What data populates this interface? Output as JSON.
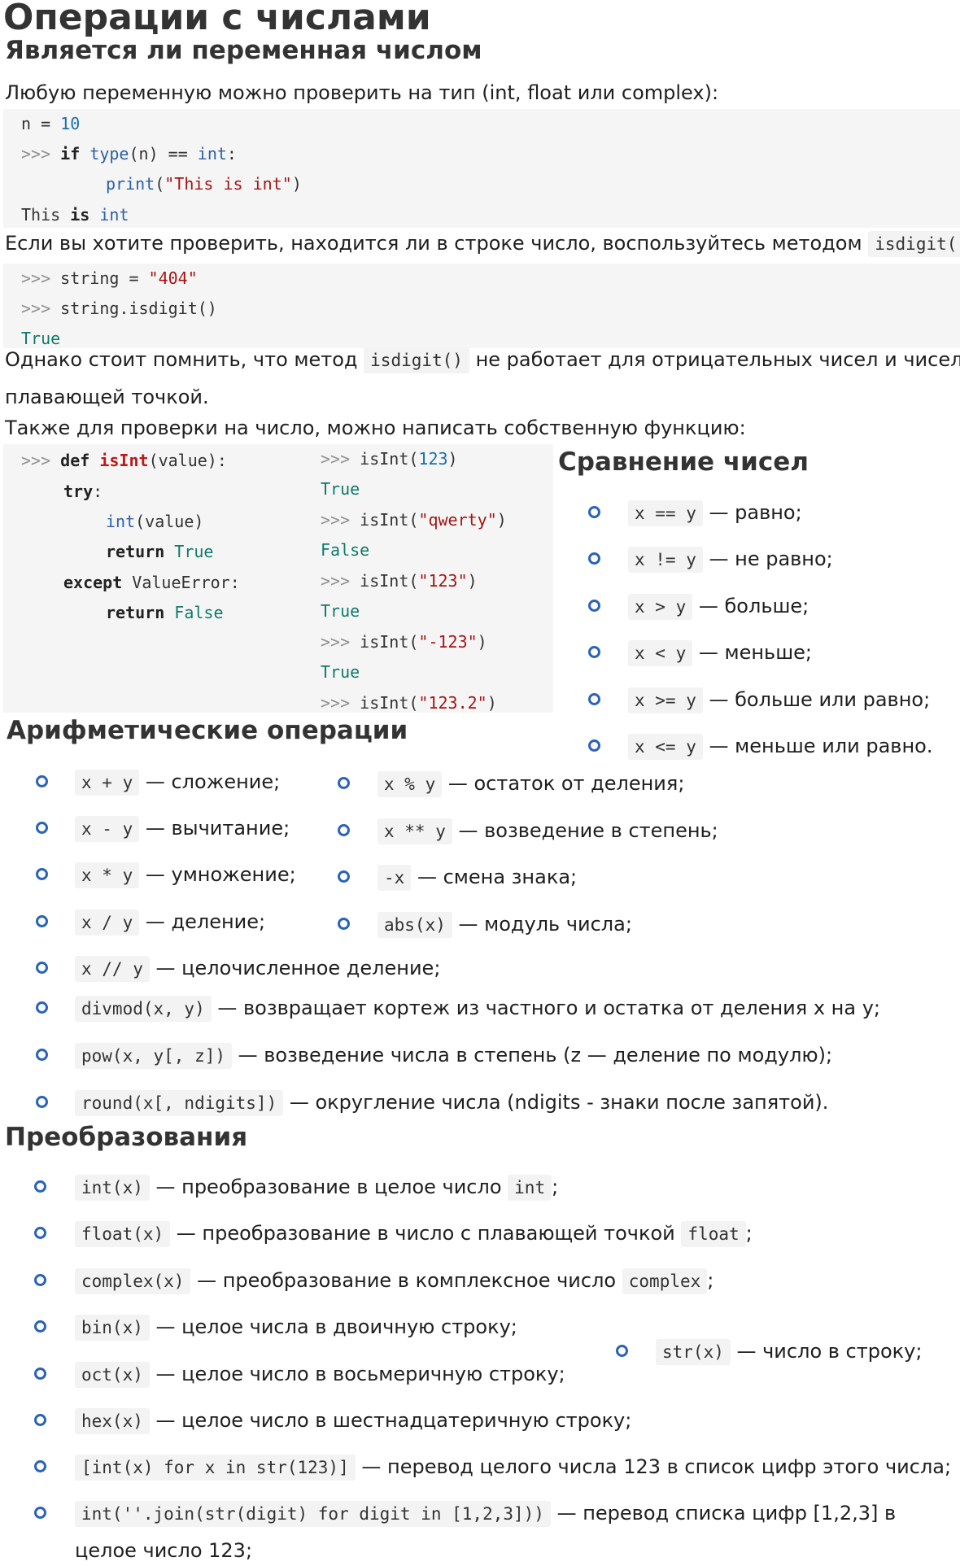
{
  "title": "Операции с числами",
  "s1": {
    "heading": "Является ли переменная числом",
    "intro": "Любую переменную можно проверить на тип (int, float или complex):",
    "code1": {
      "l1": [
        "n",
        " = ",
        "10"
      ],
      "l2": [
        ">>> ",
        "if",
        " ",
        "type",
        "(n) == ",
        "int",
        ":"
      ],
      "l3": [
        "print",
        "(",
        "\"This is int\"",
        ")"
      ],
      "l4": [
        "This ",
        "is",
        " ",
        "int"
      ]
    },
    "isdigit_text": "Если вы хотите проверить, находится ли в строке число, воспользуйтесь методом",
    "isdigit_code": "isdigit()",
    "code2": {
      "l1": [
        ">>> ",
        "string = ",
        "\"404\""
      ],
      "l2": [
        ">>> ",
        "string.isdigit()"
      ],
      "l3": "True"
    },
    "note_before": "Однако стоит помнить, что метод",
    "note_code": "isdigit()",
    "note_after": "не работает для отрицательных чисел и чисел с",
    "note_line2": "плавающей точкой.",
    "also": "Также для проверки на число, можно написать собственную функцию:"
  },
  "code3": {
    "left": {
      "l1": [
        ">>> ",
        "def",
        " ",
        "isInt",
        "(value):"
      ],
      "l2": [
        "try",
        ":"
      ],
      "l3": [
        "int",
        "(value)"
      ],
      "l4": [
        "return",
        " ",
        "True"
      ],
      "l5": [
        "except",
        " ValueError:"
      ],
      "l6": [
        "return",
        " ",
        "False"
      ]
    },
    "right": [
      {
        "p": ">>> ",
        "c": "isInt(",
        "a": "123",
        "e": ")"
      },
      {
        "r": "True"
      },
      {
        "p": ">>> ",
        "c": "isInt(",
        "a": "\"qwerty\"",
        "e": ")"
      },
      {
        "r": "False"
      },
      {
        "p": ">>> ",
        "c": "isInt(",
        "a": "\"123\"",
        "e": ")"
      },
      {
        "r": "True"
      },
      {
        "p": ">>> ",
        "c": "isInt(",
        "a": "\"-123\"",
        "e": ")"
      },
      {
        "r": "True"
      },
      {
        "p": ">>> ",
        "c": "isInt(",
        "a": "\"123.2\"",
        "e": ")"
      }
    ]
  },
  "comparison": {
    "heading": "Сравнение чисел",
    "items": [
      {
        "code": "x == y",
        "text": "— равно;"
      },
      {
        "code": "x != y",
        "text": "— не равно;"
      },
      {
        "code": "x > y",
        "text": "— больше;"
      },
      {
        "code": "x < y",
        "text": "— меньше;"
      },
      {
        "code": "x >= y",
        "text": "— больше или равно;"
      },
      {
        "code": "x <= y",
        "text": "— меньше или равно."
      }
    ]
  },
  "arith": {
    "heading": "Арифметические операции",
    "left": [
      {
        "code": "x + y",
        "text": "— сложение;"
      },
      {
        "code": "x - y",
        "text": "— вычитание;"
      },
      {
        "code": "x * y",
        "text": "— умножение;"
      },
      {
        "code": "x / y",
        "text": "— деление;"
      }
    ],
    "right": [
      {
        "code": "x % y",
        "text": "— остаток от деления;"
      },
      {
        "code": "x ** y",
        "text": "— возведение в степень;"
      },
      {
        "code": "-x",
        "text": "— смена знака;"
      },
      {
        "code": "abs(x)",
        "text": "— модуль числа;"
      }
    ],
    "full": [
      {
        "code": "x // y",
        "text": "— целочисленное деление;"
      },
      {
        "code": "divmod(x, y)",
        "text": "— возвращает кортеж из частного и остатка от деления x на y;"
      },
      {
        "code": "pow(x, y[, z])",
        "text": "— возведение числа в степень (z — деление по модулю);"
      },
      {
        "code": "round(x[, ndigits])",
        "text": "— округление числа (ndigits - знаки после запятой)."
      }
    ]
  },
  "conv": {
    "heading": "Преобразования",
    "items": [
      {
        "code": "int(x)",
        "text": "— преобразование в целое число",
        "code2": "int",
        "tail": ";"
      },
      {
        "code": "float(x)",
        "text": "— преобразование в число с плавающей точкой",
        "code2": "float",
        "tail": ";"
      },
      {
        "code": "complex(x)",
        "text": "— преобразование в комплексное число",
        "code2": "complex",
        "tail": ";"
      },
      {
        "code": "bin(x)",
        "text": "— целое числа в двоичную строку;"
      },
      {
        "code": "oct(x)",
        "text": "— целое число в восьмеричную строку;"
      },
      {
        "code": "hex(x)",
        "text": "— целое число в шестнадцатеричную строку;"
      },
      {
        "code": "[int(x) for x in str(123)]",
        "text": "— перевод целого числа 123 в список цифр этого числа;"
      },
      {
        "code": "int(''.join(str(digit) for digit in [1,2,3]))",
        "text": "— перевод списка цифр [1,2,3] в",
        "line2": "целое число 123;"
      }
    ],
    "side": {
      "code": "str(x)",
      "text": "— число в строку;"
    }
  },
  "colors": {
    "bullet": "#2a63b8",
    "code_bg": "#f5f5f5",
    "string": "#a31515",
    "builtin": "#2d60a8",
    "func": "#c01818",
    "bool": "#0f7a6b"
  }
}
